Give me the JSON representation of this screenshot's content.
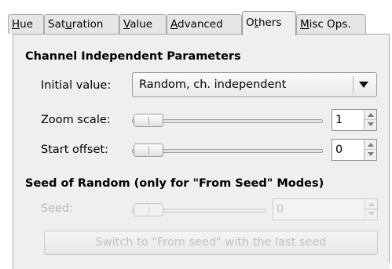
{
  "tabs": [
    {
      "prefix": "",
      "mnemonic": "H",
      "rest": "ue",
      "active": false
    },
    {
      "prefix": "Sat",
      "mnemonic": "u",
      "rest": "ration",
      "active": false
    },
    {
      "prefix": "",
      "mnemonic": "V",
      "rest": "alue",
      "active": false
    },
    {
      "prefix": "",
      "mnemonic": "A",
      "rest": "dvanced",
      "active": false
    },
    {
      "prefix": "O",
      "mnemonic": "t",
      "rest": "hers",
      "active": true
    },
    {
      "prefix": "",
      "mnemonic": "M",
      "rest": "isc Ops.",
      "active": false
    }
  ],
  "section1": {
    "title": "Channel Independent Parameters",
    "initial_value_label": "Initial value:",
    "initial_value": "Random, ch. independent",
    "zoom_label": "Zoom scale:",
    "zoom_value": "1",
    "offset_label": "Start offset:",
    "offset_value": "0"
  },
  "section2": {
    "title": "Seed of Random (only for \"From Seed\" Modes)",
    "seed_label": "Seed:",
    "seed_value": "0",
    "switch_button": "Switch to \"From seed\" with the last seed"
  }
}
